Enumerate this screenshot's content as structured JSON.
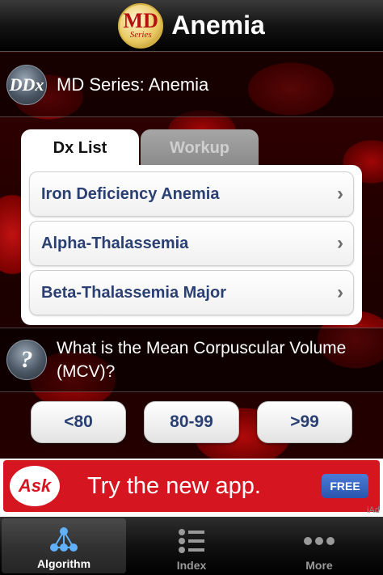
{
  "header": {
    "title": "Anemia",
    "logo_top": "MD",
    "logo_bottom": "Series"
  },
  "ddx": {
    "icon_text": "DDx",
    "label": "MD Series: Anemia"
  },
  "tabs": [
    {
      "label": "Dx List",
      "active": true
    },
    {
      "label": "Workup",
      "active": false
    }
  ],
  "diagnoses": [
    {
      "label": "Iron Deficiency Anemia"
    },
    {
      "label": "Alpha-Thalassemia"
    },
    {
      "label": "Beta-Thalassemia Major"
    }
  ],
  "question": {
    "icon_text": "?",
    "text": "What is the Mean Corpuscular Volume (MCV)?"
  },
  "answers": [
    {
      "label": "<80"
    },
    {
      "label": "80-99"
    },
    {
      "label": ">99"
    }
  ],
  "ad": {
    "brand": "Ask",
    "headline": "Try the new app.",
    "cta": "FREE",
    "network": "iAd"
  },
  "tabbar": [
    {
      "label": "Algorithm",
      "icon": "algorithm-tree-icon",
      "selected": true
    },
    {
      "label": "Index",
      "icon": "list-index-icon",
      "selected": false
    },
    {
      "label": "More",
      "icon": "more-dots-icon",
      "selected": false
    }
  ]
}
